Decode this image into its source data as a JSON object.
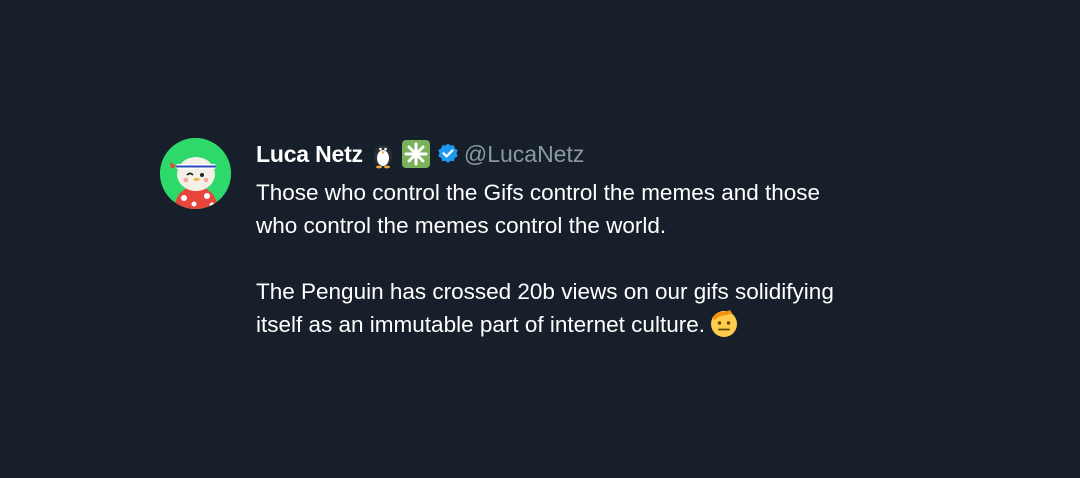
{
  "author": {
    "name": "Luca Netz",
    "handle": "@LucaNetz",
    "badges": [
      "penguin-emoji",
      "sparkle-emoji",
      "verified-badge"
    ],
    "avatar": "pudgy-penguin-avatar"
  },
  "tweet": {
    "paragraph1_line1": "Those who control the Gifs control the memes and those",
    "paragraph1_line2": "who control the memes control the world.",
    "paragraph2_line1": "The Penguin has crossed 20b views on our gifs solidifying",
    "paragraph2_line2": "itself as an immutable part of internet culture.",
    "trailing_emoji": "saluting-face-emoji"
  },
  "colors": {
    "background": "#17202a",
    "text": "#ffffff",
    "handle": "#8b98a5",
    "verified": "#1d9bf0",
    "avatar_bg": "#2dd96b"
  }
}
